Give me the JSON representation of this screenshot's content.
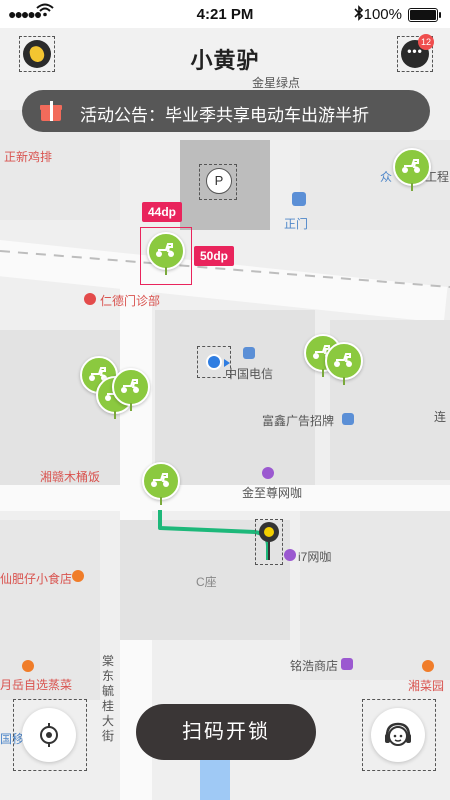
{
  "status_bar": {
    "time": "4:21 PM",
    "battery": "100%"
  },
  "header": {
    "title": "小黄驴",
    "message_badge": "12"
  },
  "notice": {
    "text": "活动公告：毕业季共享电动车出游半折"
  },
  "map": {
    "pois": {
      "zhengxin": "正新鸡排",
      "jinxing": "金星绿点",
      "zhongzhong": "众",
      "gongcheng": "工程",
      "zhengmen": "正门",
      "rende": "仁德门诊部",
      "dianxin": "中国电信",
      "fuxin": "富鑫广告招牌",
      "lian": "连",
      "xiangan": "湘赣木桶饭",
      "jinzhizun": "金至尊网咖",
      "i7": "i7网咖",
      "cseat": "C座",
      "feizai": "仙肥仔小食店",
      "yuezizhi": "月岳自选蒸菜",
      "mingao": "铭浩商店",
      "xiangcai": "湘菜园",
      "dongfeng": "棠东毓桂大街",
      "guoyi": "国移"
    },
    "price_tags": [
      "44dp",
      "50dp"
    ],
    "parking_symbol": "P"
  },
  "actions": {
    "scan_unlock": "扫码开锁"
  },
  "colors": {
    "bike": "#8bc93f",
    "tag": "#e9245c",
    "route": "#1db87a"
  }
}
